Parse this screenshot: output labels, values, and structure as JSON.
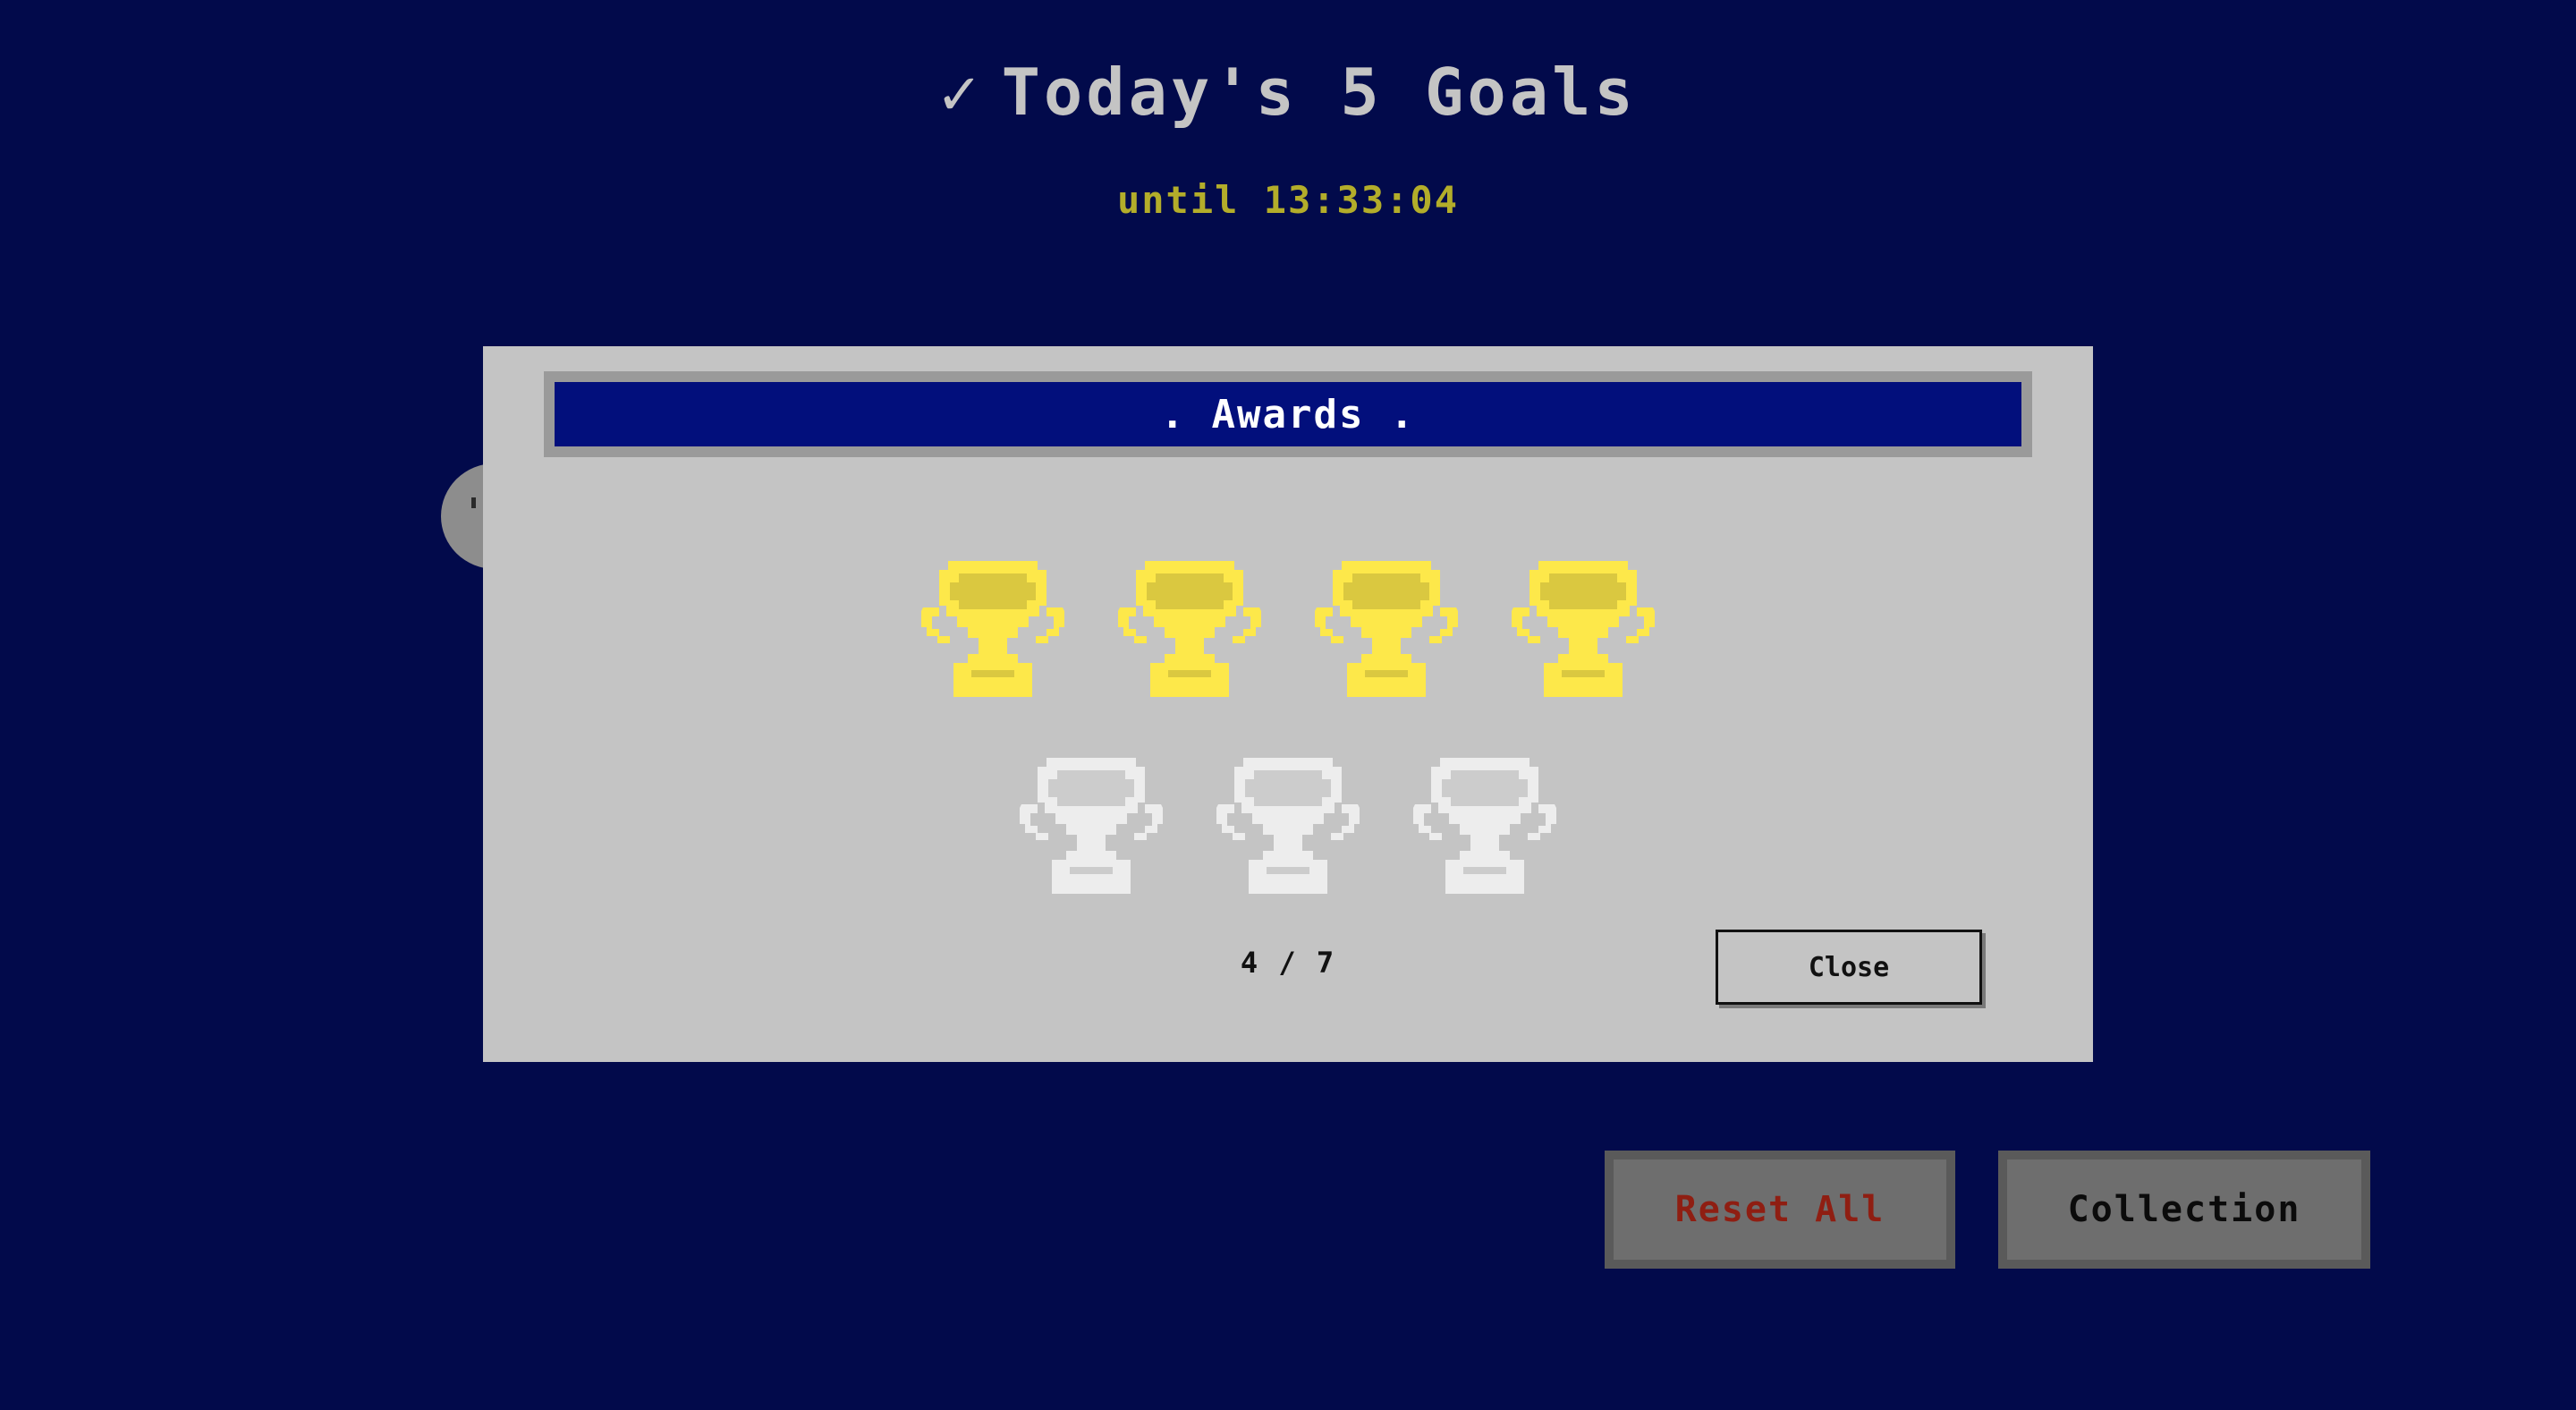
{
  "header": {
    "check_glyph": "✓",
    "title": "Today's 5 Goals",
    "countdown": "until 13:33:04"
  },
  "awards_dialog": {
    "title": ". Awards .",
    "earned": 4,
    "total": 7,
    "counter": "4 / 7",
    "close_label": "Close",
    "trophy_icon": "trophy-icon",
    "colors": {
      "earned_trophy": "#fde84a",
      "unearned_trophy": "#ededed",
      "titlebar": "#020f7c"
    }
  },
  "actions": {
    "reset_label": "Reset All",
    "collection_label": "Collection"
  },
  "colors": {
    "background": "#020a4b",
    "countdown": "#b3ad2a",
    "reset_text": "#8f1e12"
  }
}
